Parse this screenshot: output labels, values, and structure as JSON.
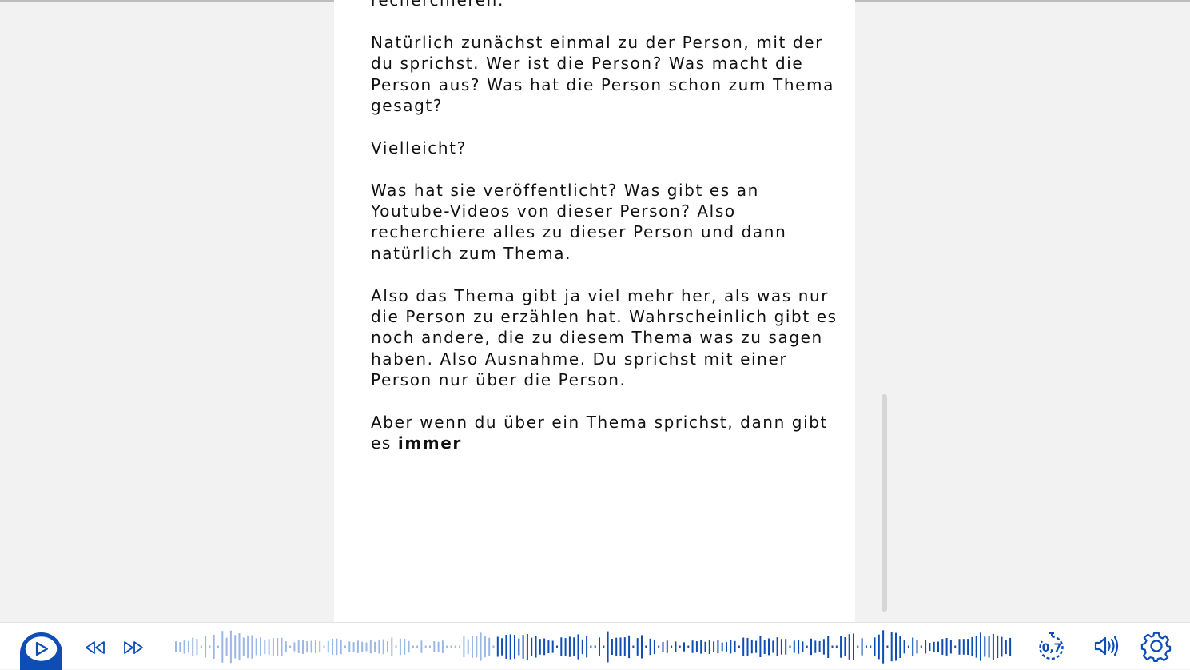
{
  "document": {
    "partial_line": "recherchieren.",
    "paragraphs": [
      "Natürlich zunächst einmal zu der Person, mit der du sprichst. Wer ist die Person? Was macht die Person aus? Was hat die Person schon zum Thema gesagt?",
      "Vielleicht?",
      "Was hat sie veröffentlicht? Was gibt es an Youtube-Videos von dieser Person? Also recherchiere alles zu dieser Person und dann natürlich zum Thema.",
      "Also das Thema gibt ja viel mehr her, als was nur die Person zu erzählen hat. Wahrscheinlich gibt es noch andere, die zu diesem Thema was zu sagen haben. Also Ausnahme. Du sprichst mit einer Person nur über die Person."
    ],
    "last_paragraph_text": "Aber wenn du über ein Thema sprichst, dann gibt es ",
    "last_paragraph_emphasis": "immer"
  },
  "player": {
    "speed_label": "0,7",
    "played_fraction": 0.38,
    "icons": {
      "play": "play-icon",
      "rewind": "rewind-icon",
      "forward": "fast-forward-icon",
      "speed": "playback-speed-icon",
      "volume": "volume-icon",
      "settings": "settings-gear-icon"
    }
  },
  "colors": {
    "accent": "#0d4db5",
    "wave_played": "#9bb7e6",
    "wave_unplayed": "#0d4db5",
    "background": "#f2f2f2",
    "page": "#ffffff"
  }
}
